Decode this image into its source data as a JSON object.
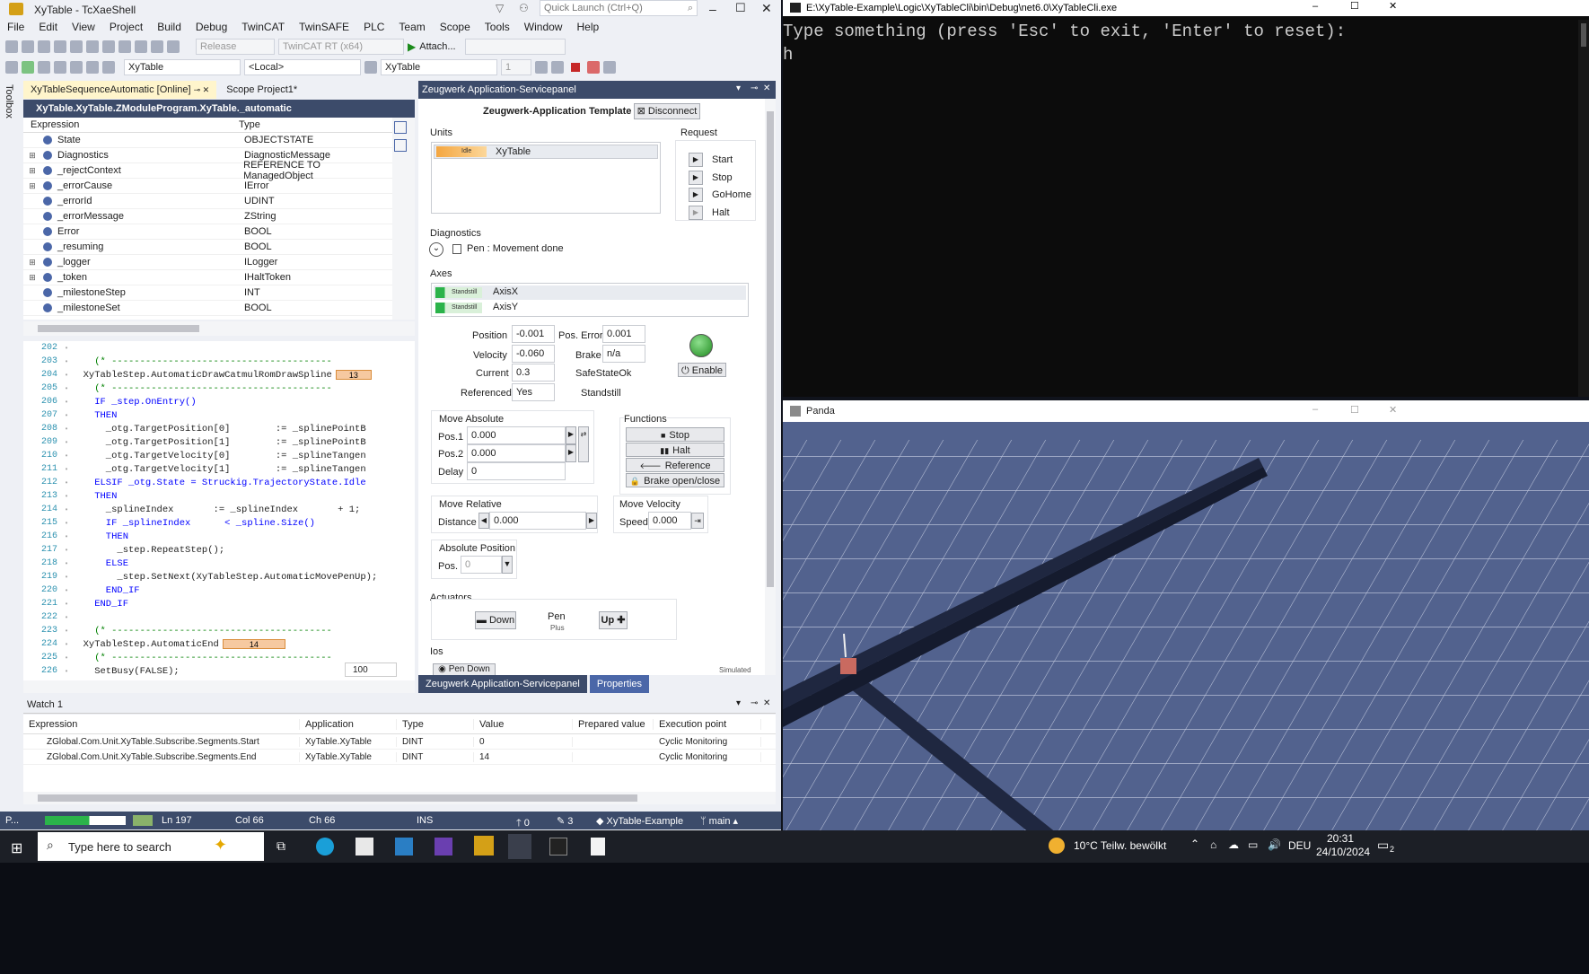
{
  "vs": {
    "title": "XyTable - TcXaeShell",
    "quick_launch": "Quick Launch (Ctrl+Q)",
    "menu": [
      "File",
      "Edit",
      "View",
      "Project",
      "Build",
      "Debug",
      "TwinCAT",
      "TwinSAFE",
      "PLC",
      "Team",
      "Scope",
      "Tools",
      "Window",
      "Help"
    ],
    "toolbar1": {
      "config": "Release",
      "platform": "TwinCAT RT (x64)",
      "attach": "Attach..."
    },
    "toolbar2": {
      "project": "XyTable",
      "target": "<Local>",
      "plc": "XyTable",
      "num": "1"
    },
    "toolbox": "Toolbox"
  },
  "editor": {
    "tabs": [
      {
        "label": "XyTableSequenceAutomatic [Online]"
      },
      {
        "label": "Scope Project1*"
      }
    ],
    "path": "XyTable.XyTable.ZModuleProgram.XyTable._automatic",
    "columns": [
      "Expression",
      "Type"
    ],
    "rows": [
      [
        "State",
        "OBJECTSTATE"
      ],
      [
        "Diagnostics",
        "DiagnosticMessage"
      ],
      [
        "_rejectContext",
        "REFERENCE TO ManagedObject"
      ],
      [
        "_errorCause",
        "IError"
      ],
      [
        "_errorId",
        "UDINT"
      ],
      [
        "_errorMessage",
        "ZString"
      ],
      [
        "Error",
        "BOOL"
      ],
      [
        "_resuming",
        "BOOL"
      ],
      [
        "_logger",
        "ILogger"
      ],
      [
        "_token",
        "IHaltToken"
      ],
      [
        "_milestoneStep",
        "INT"
      ],
      [
        "_milestoneSet",
        "BOOL"
      ]
    ],
    "lines": [
      "202",
      "203",
      "204",
      "205",
      "206",
      "207",
      "208",
      "209",
      "210",
      "211",
      "212",
      "213",
      "214",
      "215",
      "216",
      "217",
      "218",
      "219",
      "220",
      "221",
      "222",
      "223",
      "224",
      "225",
      "226"
    ],
    "code": [
      "",
      "    (* ---------------------------------------",
      "  XyTableStep.AutomaticDrawCatmulRomDrawSpline",
      "    (* ---------------------------------------",
      "    IF _step.OnEntry()",
      "    THEN",
      "      _otg.TargetPosition[0]        := _splinePointB",
      "      _otg.TargetPosition[1]        := _splinePointB",
      "      _otg.TargetVelocity[0]        := _splineTangen",
      "      _otg.TargetVelocity[1]        := _splineTangen",
      "    ELSIF _otg.State = Struckig.TrajectoryState.Idle",
      "    THEN",
      "      _splineIndex       := _splineIndex       + 1;",
      "      IF _splineIndex      < _spline.Size()",
      "      THEN",
      "        _step.RepeatStep();",
      "      ELSE",
      "        _step.SetNext(XyTableStep.AutomaticMovePenUp);",
      "      END_IF",
      "    END_IF",
      "",
      "    (* ---------------------------------------",
      "  XyTableStep.AutomaticEnd",
      "    (* ---------------------------------------",
      "    SetBusy(FALSE);"
    ],
    "val13": "13",
    "val0": "0",
    "val14": "14",
    "zoom": "100"
  },
  "sp": {
    "title": "Zeugwerk Application-Servicepanel",
    "template": "Zeugwerk-Application Template",
    "disconnect": "Disconnect",
    "units_label": "Units",
    "unit_state": "Idle",
    "unit_name": "XyTable",
    "request_label": "Request",
    "requests": [
      "Start",
      "Stop",
      "GoHome",
      "Halt"
    ],
    "diag_label": "Diagnostics",
    "diag_msg": "Pen : Movement done",
    "axes_label": "Axes",
    "axes": [
      {
        "state": "Standstill",
        "name": "AxisX"
      },
      {
        "state": "Standstill",
        "name": "AxisY"
      }
    ],
    "position_lbl": "Position",
    "position": "-0.001",
    "poserr_lbl": "Pos. Error",
    "poserr": "0.001",
    "velocity_lbl": "Velocity",
    "velocity": "-0.060",
    "brake_lbl": "Brake",
    "brake": "n/a",
    "current_lbl": "Current",
    "current": "0.3",
    "safe": "SafeStateOk",
    "referenced_lbl": "Referenced",
    "referenced": "Yes",
    "standstill": "Standstill",
    "enable": "Enable",
    "moveabs_label": "Move Absolute",
    "pos1_lbl": "Pos.1",
    "pos1": "0.000",
    "pos2_lbl": "Pos.2",
    "pos2": "0.000",
    "delay_lbl": "Delay",
    "delay": "0",
    "functions_label": "Functions",
    "functions": [
      "Stop",
      "Halt",
      "Reference",
      "Brake open/close"
    ],
    "moverel_label": "Move Relative",
    "distance_lbl": "Distance",
    "distance": "0.000",
    "movevel_label": "Move Velocity",
    "speed_lbl": "Speed",
    "speed": "0.000",
    "abspos_label": "Absolute Position",
    "abspos_lbl": "Pos.",
    "abspos": "0",
    "actuators_label": "Actuators",
    "down": "Down",
    "pen": "Pen",
    "pen_sub": "Plus",
    "up": "Up",
    "ios_label": "Ios",
    "pen_down": "Pen Down",
    "simulated": "Simulated",
    "tabs": [
      "Zeugwerk Application-Servicepanel",
      "Properties"
    ]
  },
  "watch": {
    "title": "Watch 1",
    "columns": [
      "Expression",
      "Application",
      "Type",
      "Value",
      "Prepared value",
      "Execution point"
    ],
    "rows": [
      [
        "ZGlobal.Com.Unit.XyTable.Subscribe.Segments.Start",
        "XyTable.XyTable",
        "DINT",
        "0",
        "",
        "Cyclic Monitoring"
      ],
      [
        "ZGlobal.Com.Unit.XyTable.Subscribe.Segments.End",
        "XyTable.XyTable",
        "DINT",
        "14",
        "",
        "Cyclic Monitoring"
      ]
    ]
  },
  "status": {
    "p": "P...",
    "ln": "Ln 197",
    "col": "Col 66",
    "ch": "Ch 66",
    "ins": "INS",
    "up": "0",
    "pen": "3",
    "repo": "XyTable-Example",
    "branch": "main"
  },
  "console": {
    "title": "E:\\XyTable-Example\\Logic\\XyTableCli\\bin\\Debug\\net6.0\\XyTableCli.exe",
    "line1": "Type something (press 'Esc' to exit, 'Enter' to reset):",
    "line2": "h"
  },
  "panda": {
    "title": "Panda"
  },
  "taskbar": {
    "search": "Type here to search",
    "weather": "10°C Teilw. bewölkt",
    "lang": "DEU",
    "time": "20:31",
    "date": "24/10/2024",
    "notif": "2"
  }
}
